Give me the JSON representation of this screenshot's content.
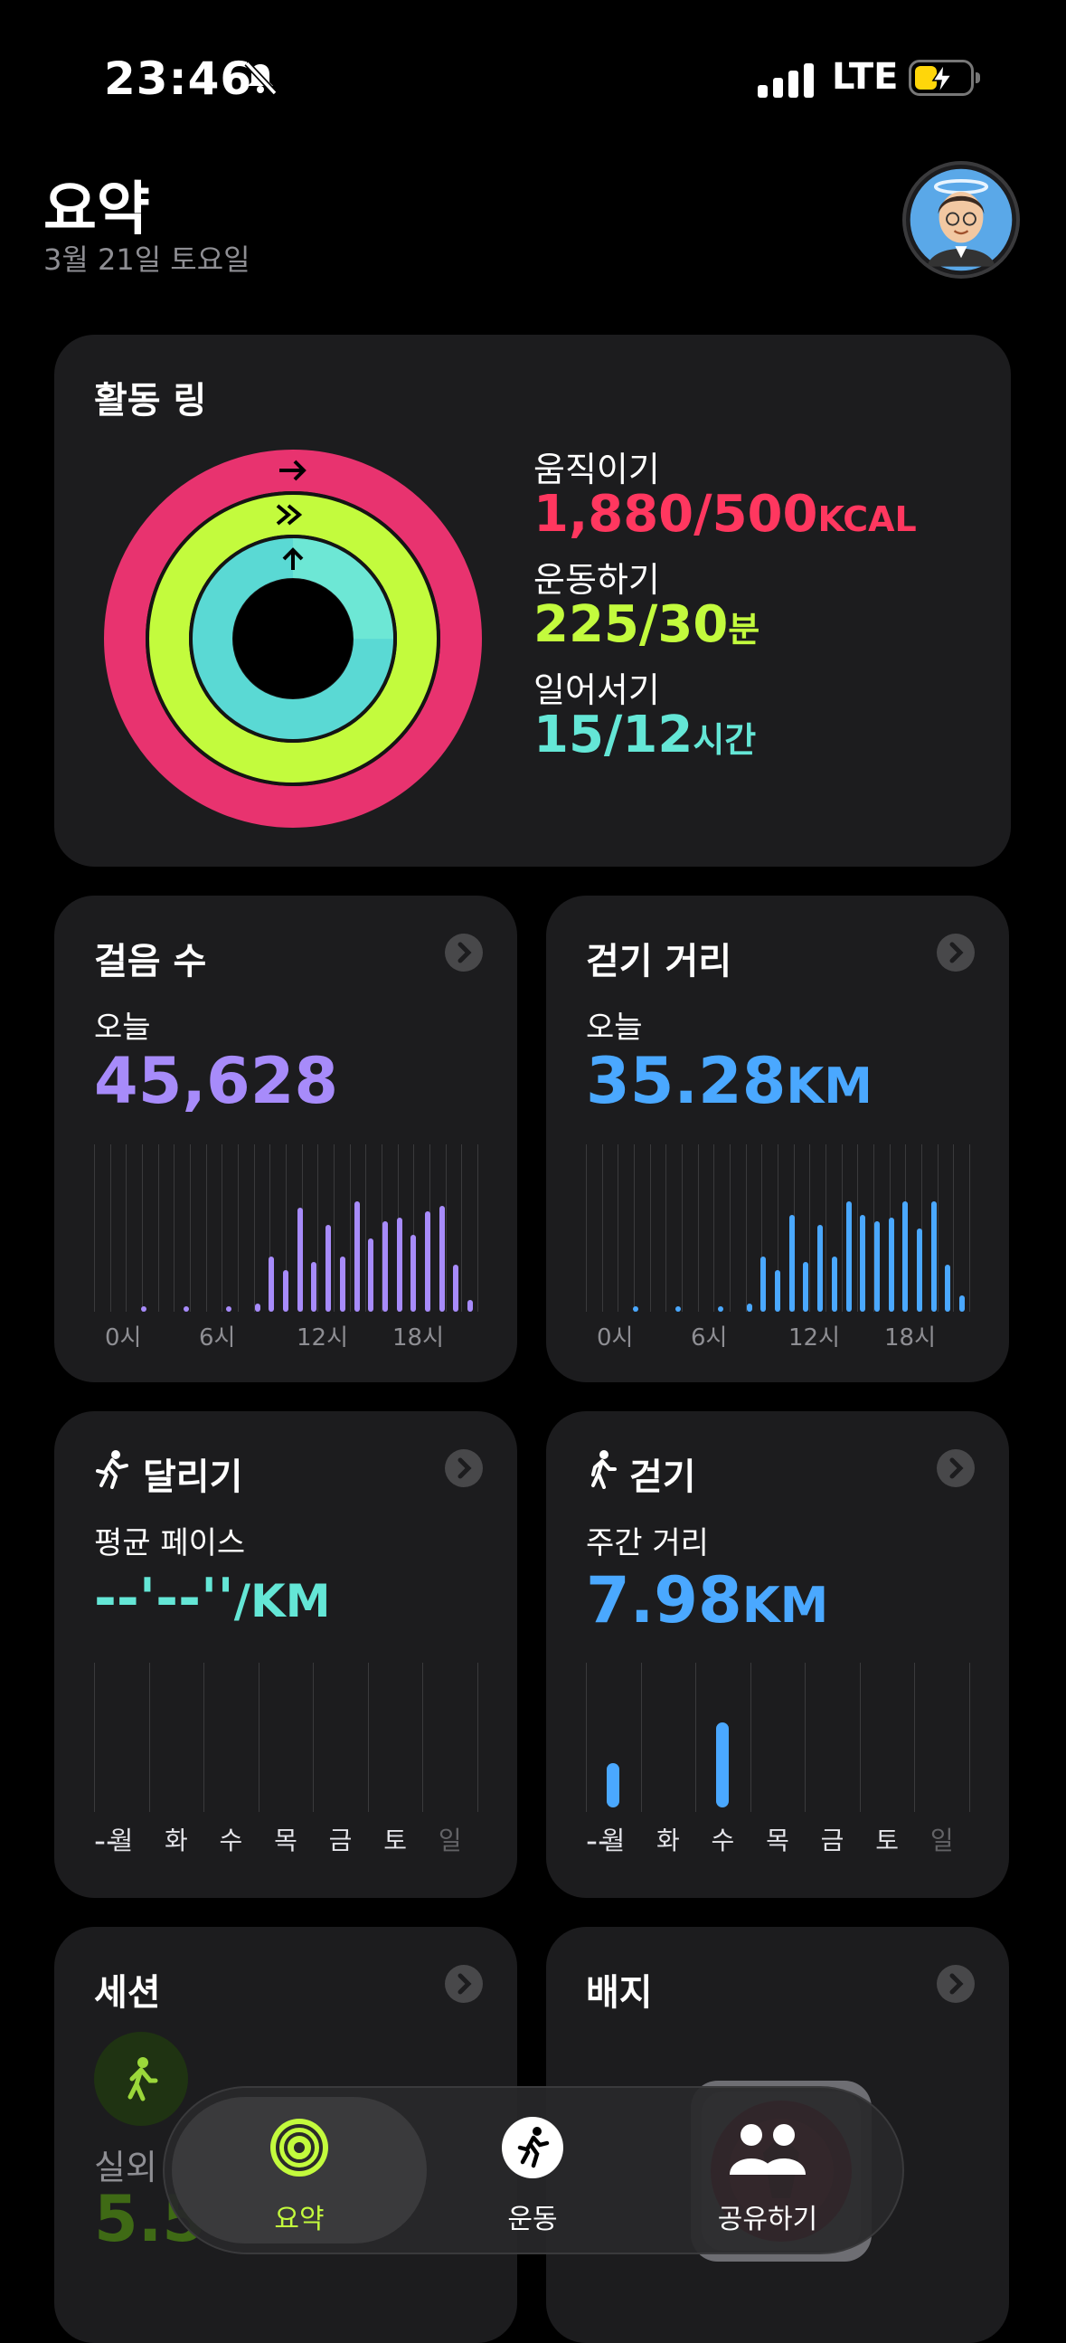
{
  "status_bar": {
    "time": "23:46",
    "network": "LTE"
  },
  "header": {
    "title": "요약",
    "date": "3월 21일 토요일"
  },
  "activity": {
    "title": "활동 링",
    "move": {
      "label": "움직이기",
      "value": "1,880/500",
      "unit": "KCAL",
      "color": "#ff375f"
    },
    "exercise": {
      "label": "운동하기",
      "value": "225/30",
      "unit": "분",
      "color": "#b3ff3b"
    },
    "stand": {
      "label": "일어서기",
      "value": "15/12",
      "unit": "시간",
      "color": "#64e6d6"
    }
  },
  "steps": {
    "title": "걸음 수",
    "sub": "오늘",
    "value": "45,628",
    "color": "#a78bfa",
    "axis": [
      "0시",
      "6시",
      "12시",
      "18시"
    ],
    "hourly": [
      0,
      0,
      0,
      0.03,
      0,
      0,
      0.03,
      0,
      0,
      0.03,
      0,
      0.05,
      0.33,
      0.25,
      0.62,
      0.3,
      0.52,
      0.33,
      0.66,
      0.44,
      0.54,
      0.56,
      0.46,
      0.6,
      0.63,
      0.28,
      0.07
    ]
  },
  "distance": {
    "title": "걷기 거리",
    "sub": "오늘",
    "value": "35.28",
    "unit": "KM",
    "color": "#4aa8ff",
    "axis": [
      "0시",
      "6시",
      "12시",
      "18시"
    ],
    "hourly": [
      0,
      0,
      0,
      0.03,
      0,
      0,
      0.03,
      0,
      0,
      0.03,
      0,
      0.05,
      0.33,
      0.25,
      0.58,
      0.3,
      0.52,
      0.33,
      0.66,
      0.58,
      0.54,
      0.56,
      0.66,
      0.5,
      0.66,
      0.28,
      0.1
    ]
  },
  "running": {
    "title": "달리기",
    "sub": "평균 페이스",
    "value": "--'--''",
    "unit": "/KM",
    "color": "#64e6d6",
    "days": [
      "월",
      "화",
      "수",
      "목",
      "금",
      "토",
      "일"
    ],
    "summary": "--"
  },
  "walking": {
    "title": "걷기",
    "sub": "주간 거리",
    "value": "7.98",
    "unit": "KM",
    "color": "#4aa8ff",
    "days": [
      "월",
      "화",
      "수",
      "목",
      "금",
      "토",
      "일"
    ],
    "summary": "--",
    "weekly": [
      0.33,
      0,
      0.63,
      0,
      0,
      0,
      0
    ]
  },
  "sessions": {
    "title": "세션",
    "sub": "실외",
    "value": "5.5"
  },
  "badges": {
    "title": "배지"
  },
  "tabbar": {
    "tabs": [
      {
        "label": "요약",
        "active": true
      },
      {
        "label": "운동",
        "active": false
      },
      {
        "label": "공유하기",
        "active": false
      }
    ]
  }
}
